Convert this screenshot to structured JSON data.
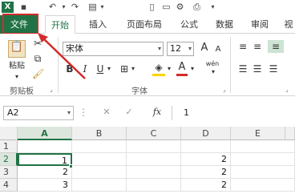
{
  "tabs": [
    "文件",
    "开始",
    "插入",
    "页面布局",
    "公式",
    "数据",
    "审阅",
    "视"
  ],
  "ribbon": {
    "paste_label": "粘贴",
    "clipboard_label": "剪贴板",
    "font_name": "宋体",
    "font_size": "12",
    "font_label": "字体",
    "bold": "B",
    "italic": "I",
    "underline": "U",
    "grow": "A",
    "shrink": "A",
    "font_color_letter": "A",
    "wen": "wén"
  },
  "formula_bar": {
    "name_box": "A2",
    "cancel": "✕",
    "enter": "✓",
    "fx": "fx",
    "value": "1"
  },
  "sheet": {
    "columns": [
      "A",
      "B",
      "C",
      "D",
      "E"
    ],
    "rows": [
      "1",
      "2",
      "3",
      "4"
    ],
    "cells": {
      "A2": "1",
      "A3": "2",
      "A4": "3",
      "D2": "2",
      "D3": "2",
      "D4": "2"
    }
  },
  "colors": {
    "accent": "#217346",
    "highlight": "#d42a2a"
  }
}
